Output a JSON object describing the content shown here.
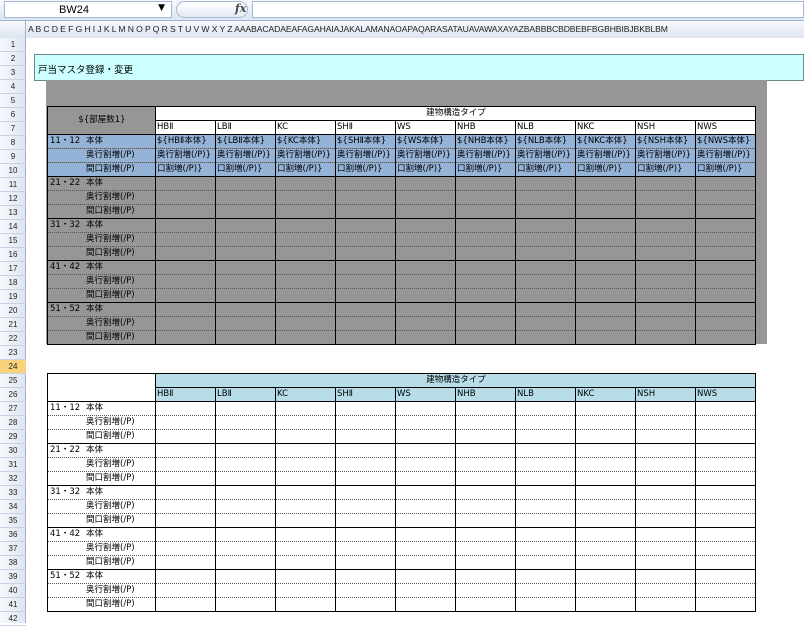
{
  "formula_bar": {
    "name_box": "BW24",
    "fx_label": "fx"
  },
  "column_header_text": "A B C D E F G H I J K L M N O P Q R S T U V W X Y Z AAABACADAEAFAGAHAIAJAKALAMANAOAPAQARASATAUAVAWAXAYAZBABBBCBDBEBFBGBHBIBJBKBLBM",
  "row_numbers": [
    "1",
    "2",
    "3",
    "4",
    "5",
    "6",
    "7",
    "8",
    "9",
    "10",
    "11",
    "12",
    "13",
    "14",
    "15",
    "16",
    "17",
    "18",
    "19",
    "20",
    "21",
    "22",
    "23",
    "24",
    "25",
    "26",
    "27",
    "28",
    "29",
    "30",
    "31",
    "32",
    "33",
    "34",
    "35",
    "36",
    "37",
    "38",
    "39",
    "40",
    "41",
    "42"
  ],
  "selected_row": "24",
  "sheet": {
    "title": "戸当マスタ登録・変更",
    "table1": {
      "corner_label": "${部屋数1}",
      "group_header": "建物構造タイプ",
      "types": [
        "HBⅡ",
        "LBⅡ",
        "KC",
        "SHⅡ",
        "WS",
        "NHB",
        "NLB",
        "NKC",
        "NSH",
        "NWS"
      ],
      "first_row_cells": [
        "${HBⅡ本体}",
        "${LBⅡ本体}",
        "${KC本体}",
        "${SHⅡ本体}",
        "${WS本体}",
        "${NHB本体}",
        "${NLB本体}",
        "${NKC本体}",
        "${NSH本体}",
        "${NWS本体}"
      ],
      "second_row_cell": "奥行割増(/P)}",
      "third_row_cell": "口割増(/P)}",
      "groups": [
        "11・12",
        "21・22",
        "31・32",
        "41・42",
        "51・52"
      ],
      "row_labels": [
        "本体",
        "奥行割増(/P)",
        "間口割増(/P)"
      ]
    },
    "table2": {
      "group_header": "建物構造タイプ",
      "types": [
        "HBⅡ",
        "LBⅡ",
        "KC",
        "SHⅡ",
        "WS",
        "NHB",
        "NLB",
        "NKC",
        "NSH",
        "NWS"
      ],
      "groups": [
        "11・12",
        "21・22",
        "31・32",
        "41・42",
        "51・52"
      ],
      "row_labels": [
        "本体",
        "奥行割増(/P)",
        "間口割増(/P)"
      ]
    }
  }
}
